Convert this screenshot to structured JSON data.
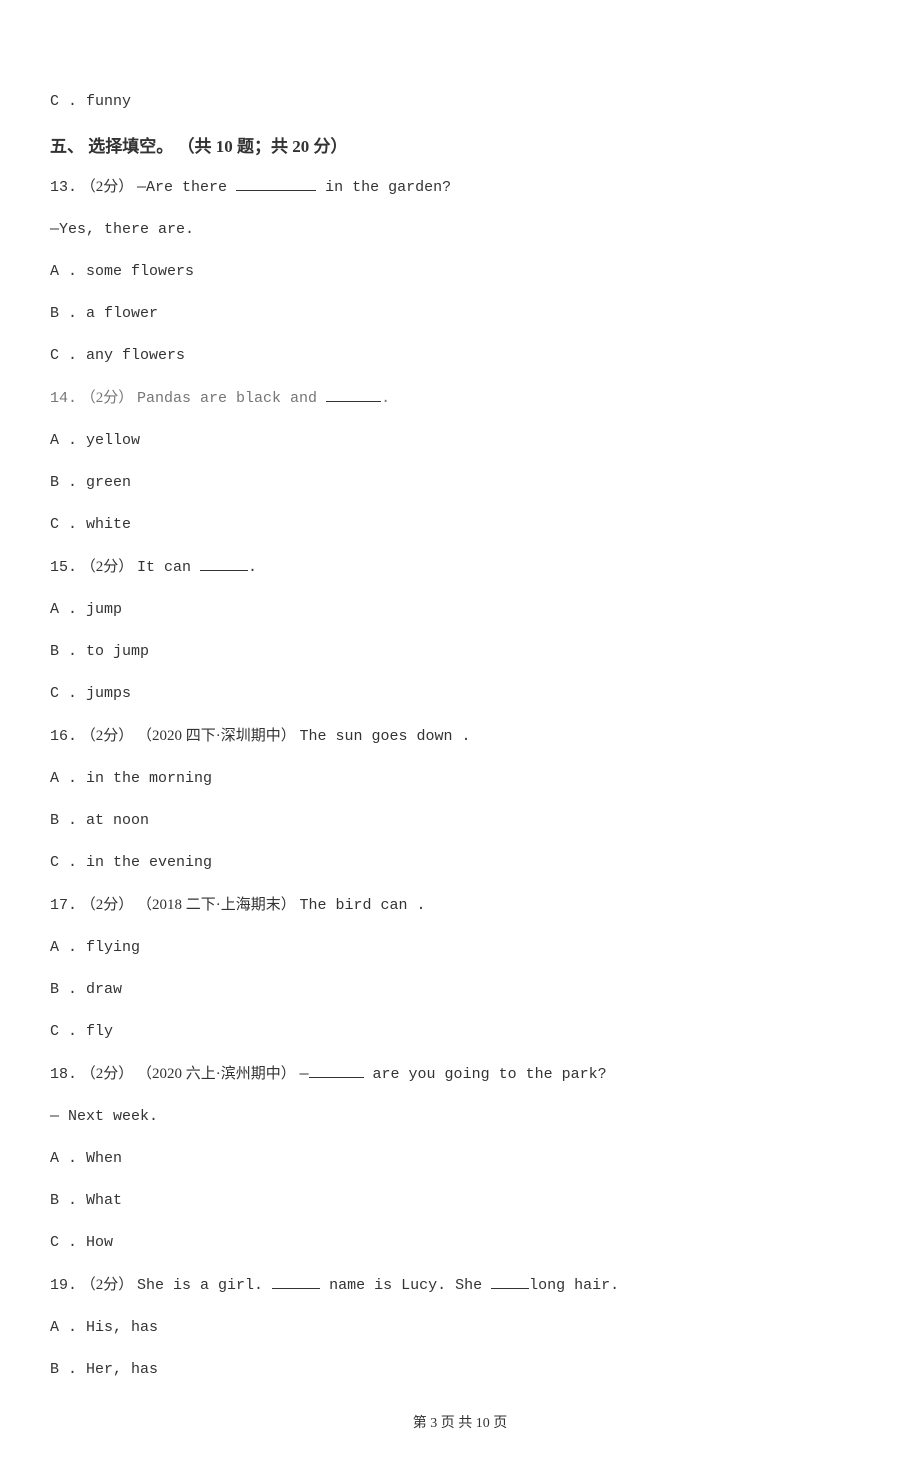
{
  "prev_option_c": "C .  funny",
  "section5": {
    "title": "五、 选择填空。 （共 10 题；共 20 分）"
  },
  "q13": {
    "num": "13.",
    "pts": "（2分）",
    "stem_a": " —Are there ",
    "stem_b": " in the garden?",
    "ans_line": "—Yes, there are.",
    "A": "A .  some flowers",
    "B": "B .  a flower",
    "C": "C .  any flowers"
  },
  "q14": {
    "num": "14.",
    "pts": "（2分）",
    "stem_a": " Pandas are black and ",
    "stem_b": ".",
    "A": "A .  yellow",
    "B": "B .  green",
    "C": "C .  white"
  },
  "q15": {
    "num": "15.",
    "pts": "（2分）",
    "stem_a": " It can ",
    "stem_b": ".",
    "A": "A .  jump",
    "B": "B .  to jump",
    "C": "C .  jumps"
  },
  "q16": {
    "num": "16.",
    "pts": "（2分）",
    "src": "（2020 四下·深圳期中）",
    "stem": "The sun goes down               .",
    "A": "A .  in the morning",
    "B": "B .  at noon",
    "C": "C .  in the evening"
  },
  "q17": {
    "num": "17.",
    "pts": "（2分）",
    "src": "（2018 二下·上海期末）",
    "stem": "The bird can          .",
    "A": "A .  flying",
    "B": "B .  draw",
    "C": "C .  fly"
  },
  "q18": {
    "num": "18.",
    "pts": "（2分）",
    "src": "（2020 六上·滨州期中）",
    "stem_a": " —",
    "stem_b": " are you going to the park?",
    "ans_line": "— Next week.",
    "A": "A .  When",
    "B": "B .  What",
    "C": "C .  How"
  },
  "q19": {
    "num": "19.",
    "pts": "（2分）",
    "stem_a": " She is a girl. ",
    "stem_b": " name is Lucy. She ",
    "stem_c": "long hair.",
    "A": "A .  His, has",
    "B": "B .  Her, has"
  },
  "footer": "第 3 页 共 10 页"
}
